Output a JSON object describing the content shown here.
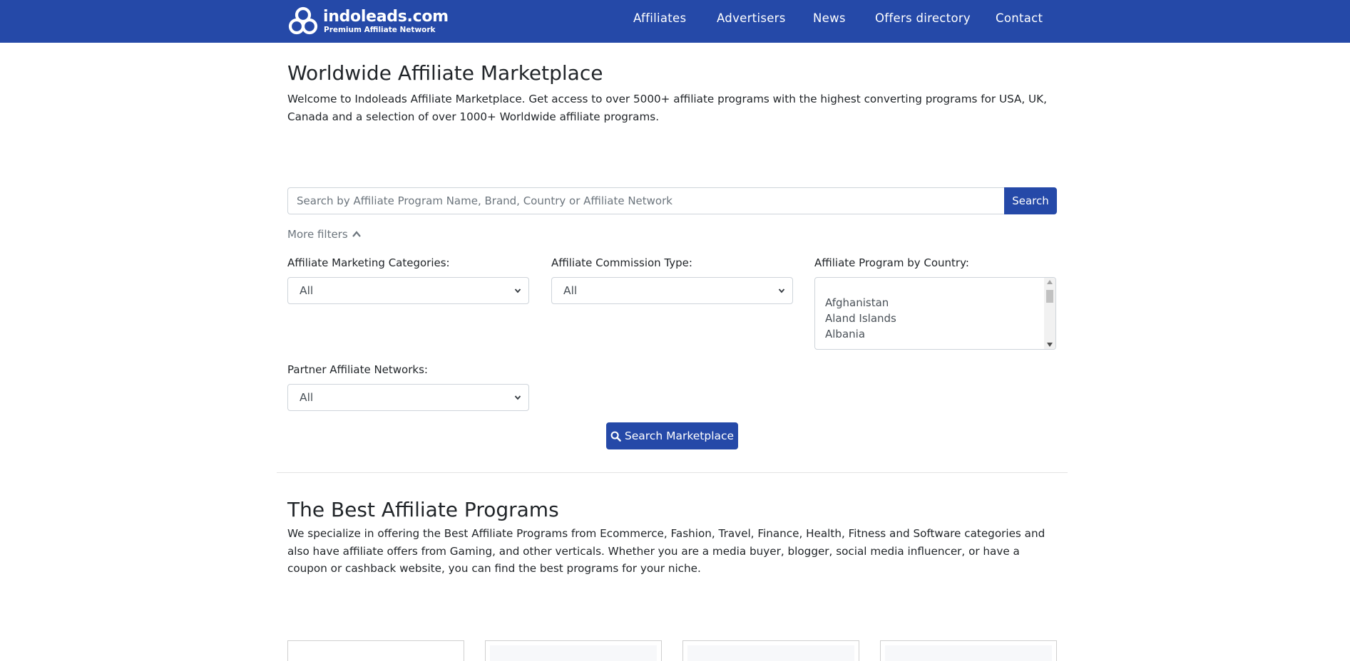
{
  "brand": {
    "name": "indoleads.com",
    "tagline": "Premium Affiliate Network"
  },
  "nav": {
    "items": [
      "Affiliates",
      "Advertisers",
      "News",
      "Offers directory",
      "Contact"
    ]
  },
  "marketplace": {
    "title": "Worldwide Affiliate Marketplace",
    "intro": "Welcome to Indoleads Affiliate Marketplace. Get access to over 5000+ affiliate programs with the highest converting programs for USA, UK, Canada and a selection of over 1000+ Worldwide affiliate programs."
  },
  "search": {
    "placeholder": "Search by Affiliate Program Name, Brand, Country or Affiliate Network",
    "value": "",
    "button_label": "Search"
  },
  "filters": {
    "toggle_label": "More filters",
    "categories": {
      "label": "Affiliate Marketing Categories:",
      "selected": "All"
    },
    "commission": {
      "label": "Affiliate Commission Type:",
      "selected": "All"
    },
    "country": {
      "label": "Affiliate Program by Country:",
      "options": [
        "Afghanistan",
        "Aland Islands",
        "Albania"
      ]
    },
    "networks": {
      "label": "Partner Affiliate Networks:",
      "selected": "All"
    },
    "submit_label": "Search Marketplace"
  },
  "best_programs": {
    "title": "The Best Affiliate Programs",
    "description": "We specialize in offering the Best Affiliate Programs from Ecommerce, Fashion, Travel, Finance, Health, Fitness and Software categories and also have affiliate offers from Gaming, and other verticals. Whether you are a media buyer, blogger, social media influencer, or have a coupon or cashback website, you can find the best programs for your niche."
  },
  "colors": {
    "primary": "#2549a8",
    "text": "#212529",
    "muted": "#6c757d",
    "border": "#ced4da"
  },
  "icons": {
    "logo": "indoleads-logo-icon",
    "filters_toggle": "chevron-up-icon",
    "select_arrow": "chevron-down-icon",
    "search_button": "search-icon"
  }
}
